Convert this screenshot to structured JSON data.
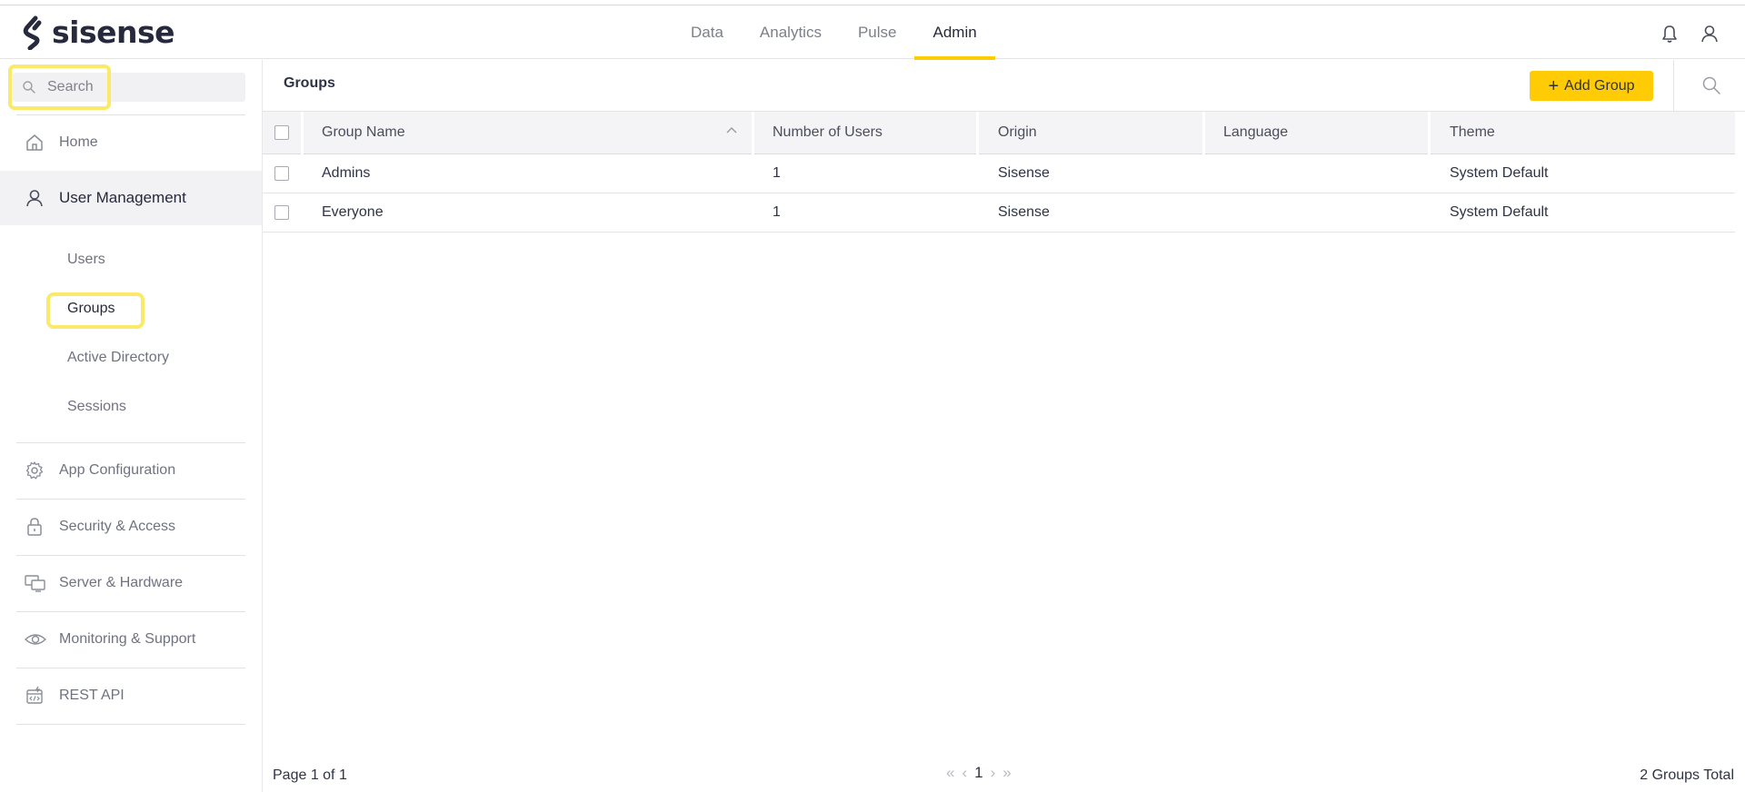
{
  "app": {
    "brand": "sisense"
  },
  "topnav": {
    "items": [
      {
        "label": "Data"
      },
      {
        "label": "Analytics"
      },
      {
        "label": "Pulse"
      },
      {
        "label": "Admin"
      }
    ],
    "active": "Admin",
    "icons": [
      "bell-icon",
      "user-icon"
    ]
  },
  "sidebar": {
    "search_placeholder": "Search",
    "home": "Home",
    "user_management": "User Management",
    "sub_items": [
      "Users",
      "Groups",
      "Active Directory",
      "Sessions"
    ],
    "current_sub": "Groups",
    "sections": [
      {
        "label": "App Configuration",
        "icon": "gear-icon"
      },
      {
        "label": "Security & Access",
        "icon": "lock-icon"
      },
      {
        "label": "Server & Hardware",
        "icon": "server-icon"
      },
      {
        "label": "Monitoring & Support",
        "icon": "eye-icon"
      },
      {
        "label": "REST API",
        "icon": "api-icon"
      }
    ]
  },
  "main": {
    "title": "Groups",
    "add_button": "Add Group",
    "table": {
      "columns": [
        "Group Name",
        "Number of Users",
        "Origin",
        "Language",
        "Theme"
      ],
      "rows": [
        [
          "Admins",
          "1",
          "Sisense",
          "",
          "System Default"
        ],
        [
          "Everyone",
          "1",
          "Sisense",
          "",
          "System Default"
        ]
      ]
    },
    "footer": {
      "page_info": "Page 1 of 1",
      "current_page": "1",
      "total": "2 Groups Total"
    }
  },
  "colors": {
    "accent": "#ffcb05",
    "highlight": "#fbe96a",
    "text": "#2e3345"
  }
}
